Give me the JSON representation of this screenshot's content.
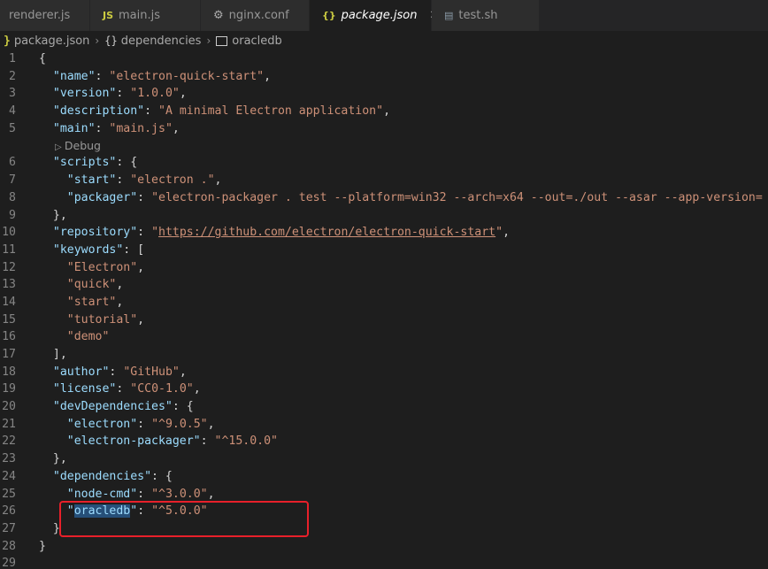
{
  "tabs": [
    {
      "icon": "",
      "label": "renderer.js",
      "active": false
    },
    {
      "icon": "JS",
      "label": "main.js",
      "active": false
    },
    {
      "icon": "⚙",
      "label": "nginx.conf",
      "active": false
    },
    {
      "icon": "{}",
      "label": "package.json",
      "active": true
    },
    {
      "icon": "▤",
      "label": "test.sh",
      "active": false
    }
  ],
  "breadcrumb": {
    "file": "package.json",
    "section": "dependencies",
    "item": "oracledb"
  },
  "codelens": "Debug",
  "code": {
    "l1": "{",
    "name_key": "\"name\"",
    "name_val": "\"electron-quick-start\"",
    "version_key": "\"version\"",
    "version_val": "\"1.0.0\"",
    "desc_key": "\"description\"",
    "desc_val": "\"A minimal Electron application\"",
    "main_key": "\"main\"",
    "main_val": "\"main.js\"",
    "scripts_key": "\"scripts\"",
    "start_key": "\"start\"",
    "start_val": "\"electron .\"",
    "packager_key": "\"packager\"",
    "packager_val": "\"electron-packager . test --platform=win32 --arch=x64 --out=./out --asar --app-version=",
    "repo_key": "\"repository\"",
    "repo_val_open": "\"",
    "repo_url": "https://github.com/electron/electron-quick-start",
    "repo_val_close": "\"",
    "keywords_key": "\"keywords\"",
    "kw1": "\"Electron\"",
    "kw2": "\"quick\"",
    "kw3": "\"start\"",
    "kw4": "\"tutorial\"",
    "kw5": "\"demo\"",
    "author_key": "\"author\"",
    "author_val": "\"GitHub\"",
    "license_key": "\"license\"",
    "license_val": "\"CC0-1.0\"",
    "devdeps_key": "\"devDependencies\"",
    "electron_key": "\"electron\"",
    "electron_val": "\"^9.0.5\"",
    "ep_key": "\"electron-packager\"",
    "ep_val": "\"^15.0.0\"",
    "deps_key": "\"dependencies\"",
    "nodecmd_key": "\"node-cmd\"",
    "nodecmd_val": "\"^3.0.0\"",
    "oracle_q1": "\"",
    "oracle_word": "oracledb",
    "oracle_q2": "\"",
    "oracle_val": "\"^5.0.0\""
  },
  "line_numbers": [
    "1",
    "2",
    "3",
    "4",
    "5",
    "6",
    "7",
    "8",
    "9",
    "10",
    "11",
    "12",
    "13",
    "14",
    "15",
    "16",
    "17",
    "18",
    "19",
    "20",
    "21",
    "22",
    "23",
    "24",
    "25",
    "26",
    "27",
    "28",
    "29"
  ]
}
